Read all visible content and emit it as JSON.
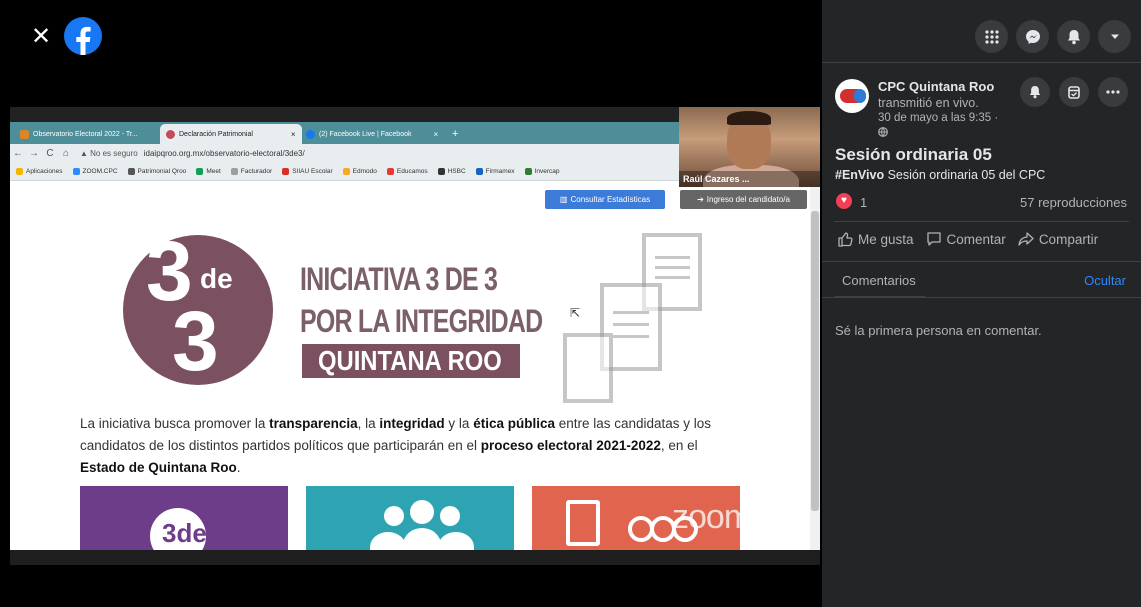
{
  "viewer": {
    "close_icon": "close-icon",
    "logo_icon": "facebook-logo-icon"
  },
  "browser": {
    "tabs": [
      {
        "label": "Observatorio Electoral 2022 - Tr...",
        "close": "×",
        "color": "#d9862b"
      },
      {
        "label": "Declaración Patrimonial",
        "close": "×",
        "color": "#c44b5a"
      },
      {
        "label": "(2) Facebook Live | Facebook",
        "close": "×",
        "color": "#1877f2"
      }
    ],
    "new_tab": "+",
    "security": "▲ No es seguro",
    "url": "idaipqroo.org.mx/observatorio-electoral/3de3/",
    "bookmarks": [
      {
        "label": "Aplicaciones",
        "color": "#f4b400"
      },
      {
        "label": "ZOOM.CPC",
        "color": "#2d8cff"
      },
      {
        "label": "Patrimonial Qroo",
        "color": "#555555"
      },
      {
        "label": "Meet",
        "color": "#0f9d58"
      },
      {
        "label": "Facturador",
        "color": "#9e9e9e"
      },
      {
        "label": "SIIAU Escolar",
        "color": "#d93025"
      },
      {
        "label": "Edmodo",
        "color": "#f9a825"
      },
      {
        "label": "Educamos",
        "color": "#e53935"
      },
      {
        "label": "HSBC",
        "color": "#333333"
      },
      {
        "label": "Firmamex",
        "color": "#1565c0"
      },
      {
        "label": "Invercap",
        "color": "#2e7d32"
      }
    ]
  },
  "webpage": {
    "btn_stats": "Consultar Estadísticas",
    "btn_login": "Ingreso del candidato/a",
    "logo_3a": "3",
    "logo_de": "de",
    "logo_3b": "3",
    "headline1": "INICIATIVA 3 DE 3",
    "headline2": "POR LA INTEGRIDAD",
    "headline3": "QUINTANA ROO",
    "desc": {
      "p1": "La iniciativa busca promover la ",
      "b1": "transparencia",
      "p2": ", la ",
      "b2": "integridad",
      "p3": " y la ",
      "b3": "ética pública",
      "p4": " entre las candidatas y los candidatos de los distintos partidos políticos que participarán en el ",
      "b4": "proceso electoral 2021-2022",
      "p5": ", en el ",
      "b5": "Estado de Quintana Roo",
      "p6": "."
    },
    "card1_logo": "3de",
    "zoom_watermark": "zoom"
  },
  "webcam": {
    "name": "Raúl Cazares ..."
  },
  "sidebar": {
    "top_icons": [
      "apps-grid-icon",
      "messenger-icon",
      "notifications-icon",
      "account-menu-icon"
    ],
    "page_name": "CPC Quintana Roo",
    "action": "transmitió en vivo.",
    "date": "30 de mayo a las 9:35 ·",
    "title": "Sesión ordinaria 05",
    "desc_hashtag": "#EnVivo",
    "desc_text": " Sesión ordinaria 05 del CPC",
    "reactions": "1",
    "views": "57 reproducciones",
    "like": "Me gusta",
    "comment": "Comentar",
    "share": "Compartir",
    "tab_comments": "Comentarios",
    "hide": "Ocultar",
    "no_comments": "Sé la primera persona en comentar."
  },
  "colors": {
    "sidebar_bg": "#242526",
    "link_blue": "#2d88ff",
    "brand_blue": "#1877f2",
    "logo_purple": "#7b5060",
    "love_red": "#f33e58"
  }
}
